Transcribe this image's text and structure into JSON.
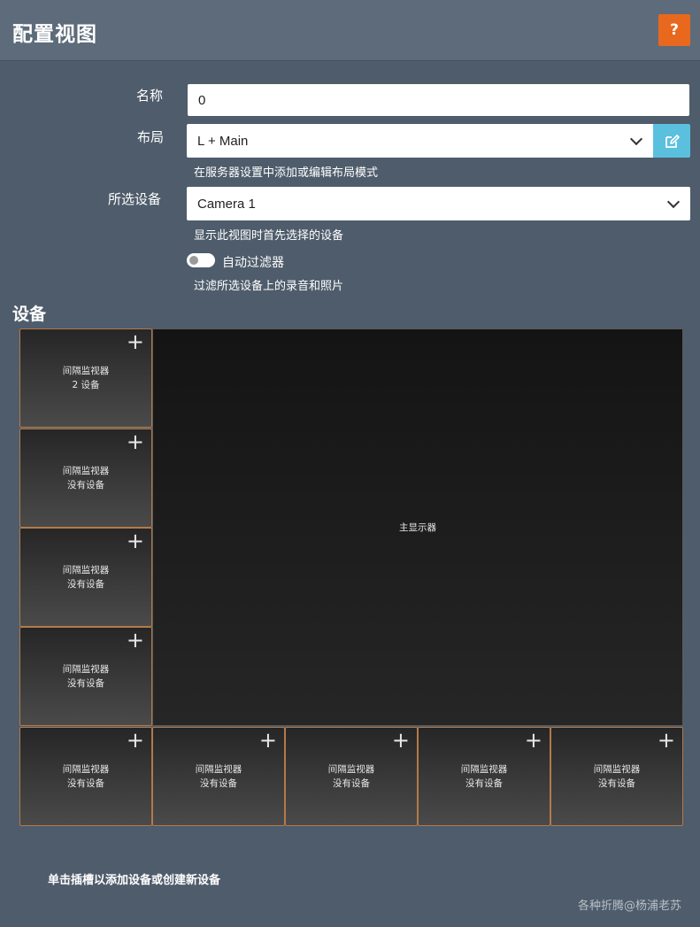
{
  "header": {
    "title": "配置视图",
    "help_label": "?"
  },
  "form": {
    "name_label": "名称",
    "name_value": "0",
    "layout_label": "布局",
    "layout_value": "L + Main",
    "layout_hint": "在服务器设置中添加或编辑布局模式",
    "device_label": "所选设备",
    "device_value": "Camera 1",
    "device_hint": "显示此视图时首先选择的设备",
    "auto_filter_label": "自动过滤器",
    "auto_filter_enabled": false,
    "auto_filter_hint": "过滤所选设备上的录音和照片"
  },
  "devices": {
    "section_title": "设备",
    "main_display_label": "主显示器",
    "slots": [
      {
        "title": "间隔监视器",
        "subtitle": "2 设备"
      },
      {
        "title": "间隔监视器",
        "subtitle": "没有设备"
      },
      {
        "title": "间隔监视器",
        "subtitle": "没有设备"
      },
      {
        "title": "间隔监视器",
        "subtitle": "没有设备"
      },
      {
        "title": "间隔监视器",
        "subtitle": "没有设备"
      },
      {
        "title": "间隔监视器",
        "subtitle": "没有设备"
      },
      {
        "title": "间隔监视器",
        "subtitle": "没有设备"
      },
      {
        "title": "间隔监视器",
        "subtitle": "没有设备"
      },
      {
        "title": "间隔监视器",
        "subtitle": "没有设备"
      }
    ],
    "add_symbol": "+"
  },
  "footer": {
    "hint": "单击插槽以添加设备或创建新设备",
    "watermark": "各种折腾@杨浦老苏"
  },
  "colors": {
    "background": "#4e5c6b",
    "header": "#5d6b7a",
    "help_button": "#e8691e",
    "edit_button": "#5bc0de",
    "slot_border": "#b47a48"
  }
}
